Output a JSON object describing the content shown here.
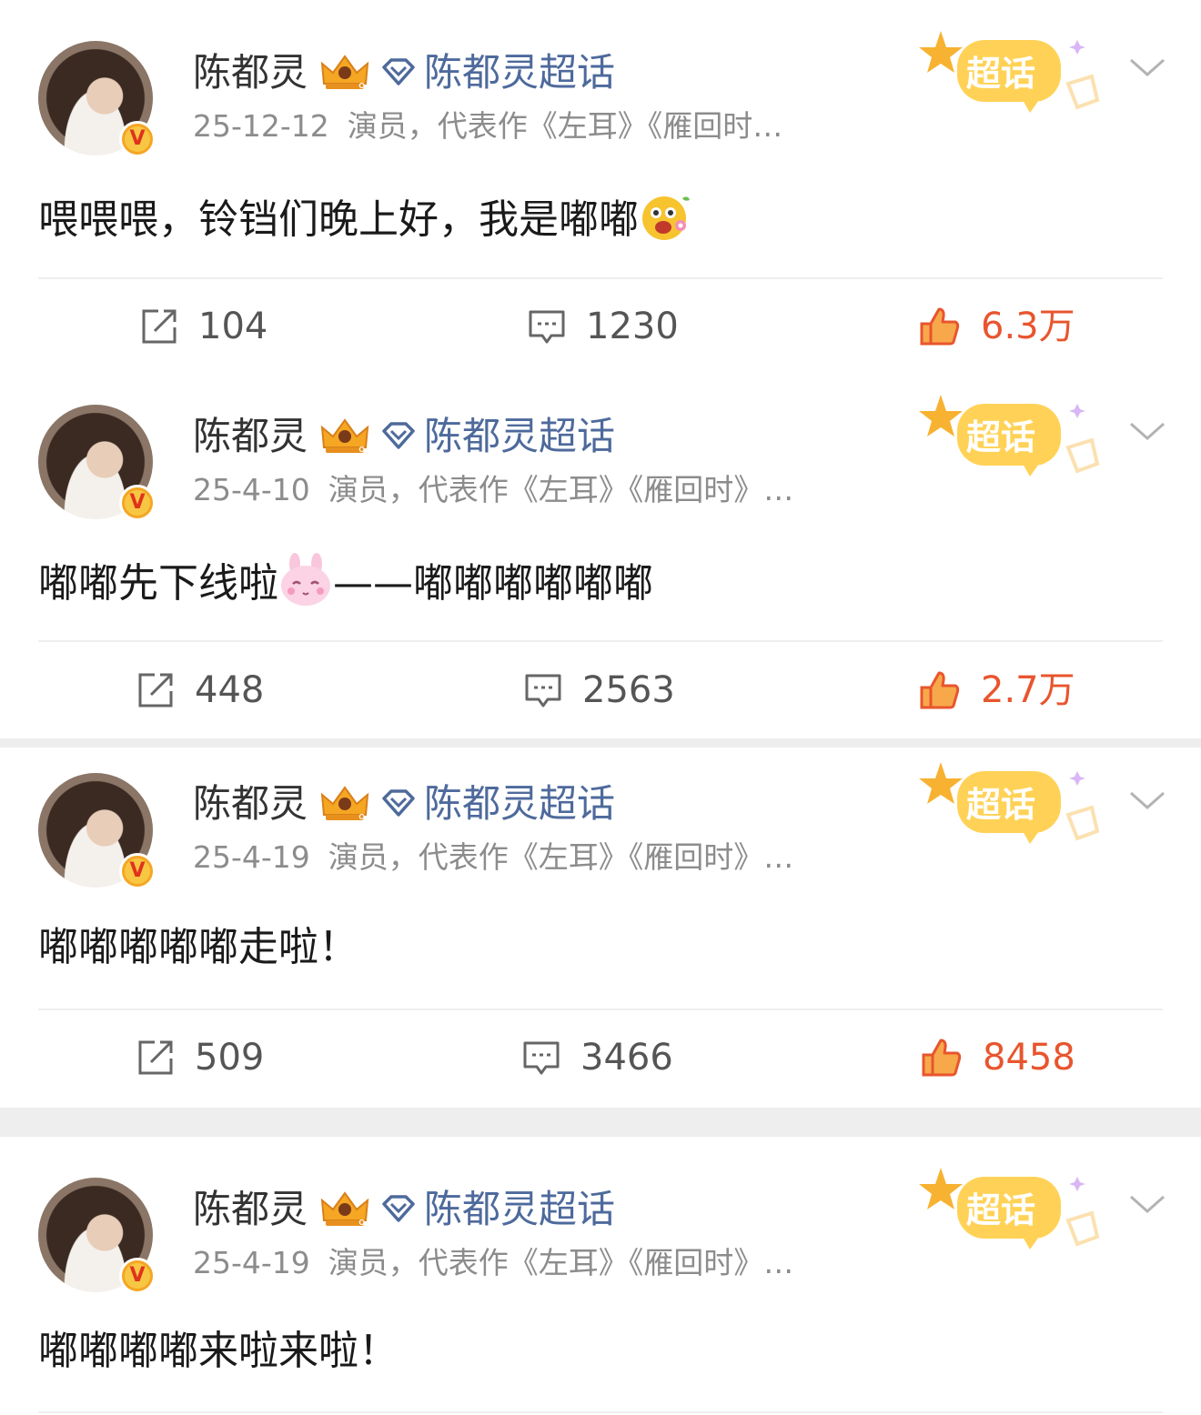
{
  "posts": [
    {
      "author": "陈都灵",
      "supertopic": "陈都灵超话",
      "date": "25-12-12",
      "bio": "演员，代表作《左耳》《雁回时…",
      "text": "喂喂喂，铃铛们晚上好，我是嘟嘟",
      "text_after_emoji": "",
      "emoji": "laughing-flower-emoji",
      "badge_label": "超话",
      "reposts": "104",
      "comments": "1230",
      "likes": "6.3万"
    },
    {
      "author": "陈都灵",
      "supertopic": "陈都灵超话",
      "date": "25-4-10",
      "bio": "演员，代表作《左耳》《雁回时》…",
      "text": "嘟嘟先下线啦",
      "text_after_emoji": "——嘟嘟嘟嘟嘟嘟",
      "emoji": "pink-bunny-emoji",
      "badge_label": "超话",
      "reposts": "448",
      "comments": "2563",
      "likes": "2.7万"
    },
    {
      "author": "陈都灵",
      "supertopic": "陈都灵超话",
      "date": "25-4-19",
      "bio": "演员，代表作《左耳》《雁回时》…",
      "text": "嘟嘟嘟嘟嘟走啦！",
      "text_after_emoji": "",
      "emoji": "",
      "badge_label": "超话",
      "reposts": "509",
      "comments": "3466",
      "likes": "8458"
    },
    {
      "author": "陈都灵",
      "supertopic": "陈都灵超话",
      "date": "25-4-19",
      "bio": "演员，代表作《左耳》《雁回时》…",
      "text": "嘟嘟嘟嘟来啦来啦！",
      "text_after_emoji": "",
      "emoji": "",
      "badge_label": "超话",
      "reposts": "",
      "comments": "",
      "likes": ""
    }
  ],
  "colors": {
    "link": "#4e6a9c",
    "like": "#e8552e",
    "meta": "#8c8c8c",
    "separator": "#eeeeee"
  }
}
